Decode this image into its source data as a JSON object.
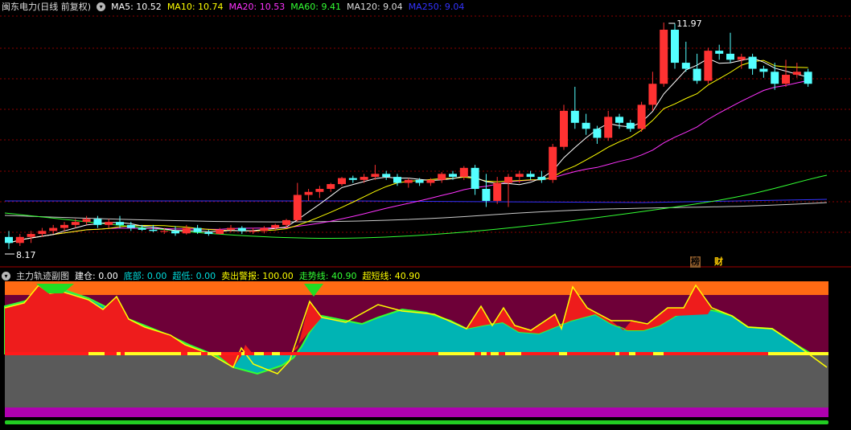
{
  "main": {
    "title": "闽东电力(日线 前复权)",
    "indicators": [
      {
        "label": "MA5: 10.52",
        "color": "#ffffff"
      },
      {
        "label": "MA10: 10.74",
        "color": "#ffff00"
      },
      {
        "label": "MA20: 10.53",
        "color": "#ff33ff"
      },
      {
        "label": "MA60: 9.41",
        "color": "#33ff33"
      },
      {
        "label": "MA120: 9.04",
        "color": "#dddddd"
      },
      {
        "label": "MA250: 9.04",
        "color": "#3333ff"
      }
    ],
    "high_label": "11.97",
    "low_label": "8.17",
    "tags": [
      "榜",
      "财"
    ]
  },
  "sub": {
    "title": "主力轨迹副图",
    "indicators": [
      {
        "label": "建仓: 0.00",
        "color": "#ffffff"
      },
      {
        "label": "底部: 0.00",
        "color": "#00dddd"
      },
      {
        "label": "超低: 0.00",
        "color": "#00dddd"
      },
      {
        "label": "卖出警报: 100.00",
        "color": "#ffff00"
      },
      {
        "label": "走势线: 40.90",
        "color": "#33ff33"
      },
      {
        "label": "超短线: 40.90",
        "color": "#ffff00"
      }
    ]
  },
  "colors": {
    "up": "#ff3232",
    "down": "#54ffff",
    "grid": "#8b0000"
  },
  "chart_data": {
    "type": "candlestick",
    "candles": [
      [
        8.4,
        8.5,
        8.2,
        8.3
      ],
      [
        8.3,
        8.45,
        8.25,
        8.4
      ],
      [
        8.4,
        8.5,
        8.3,
        8.45
      ],
      [
        8.45,
        8.55,
        8.4,
        8.5
      ],
      [
        8.5,
        8.6,
        8.45,
        8.55
      ],
      [
        8.55,
        8.65,
        8.5,
        8.6
      ],
      [
        8.6,
        8.7,
        8.55,
        8.65
      ],
      [
        8.65,
        8.75,
        8.6,
        8.7
      ],
      [
        8.7,
        8.75,
        8.55,
        8.6
      ],
      [
        8.6,
        8.7,
        8.55,
        8.65
      ],
      [
        8.65,
        8.75,
        8.55,
        8.6
      ],
      [
        8.6,
        8.65,
        8.5,
        8.55
      ],
      [
        8.55,
        8.6,
        8.5,
        8.52
      ],
      [
        8.52,
        8.6,
        8.48,
        8.5
      ],
      [
        8.5,
        8.55,
        8.45,
        8.5
      ],
      [
        8.5,
        8.58,
        8.42,
        8.46
      ],
      [
        8.46,
        8.6,
        8.44,
        8.55
      ],
      [
        8.55,
        8.6,
        8.45,
        8.48
      ],
      [
        8.48,
        8.52,
        8.42,
        8.45
      ],
      [
        8.45,
        8.55,
        8.44,
        8.52
      ],
      [
        8.52,
        8.6,
        8.48,
        8.55
      ],
      [
        8.55,
        8.58,
        8.45,
        8.5
      ],
      [
        8.5,
        8.55,
        8.45,
        8.5
      ],
      [
        8.5,
        8.58,
        8.46,
        8.55
      ],
      [
        8.55,
        8.62,
        8.5,
        8.6
      ],
      [
        8.6,
        8.7,
        8.55,
        8.68
      ],
      [
        8.68,
        9.3,
        8.65,
        9.1
      ],
      [
        9.1,
        9.2,
        9.0,
        9.15
      ],
      [
        9.15,
        9.25,
        9.05,
        9.2
      ],
      [
        9.2,
        9.3,
        9.15,
        9.28
      ],
      [
        9.28,
        9.4,
        9.25,
        9.38
      ],
      [
        9.38,
        9.42,
        9.3,
        9.35
      ],
      [
        9.35,
        9.45,
        9.3,
        9.4
      ],
      [
        9.4,
        9.6,
        9.35,
        9.45
      ],
      [
        9.45,
        9.5,
        9.35,
        9.4
      ],
      [
        9.4,
        9.45,
        9.25,
        9.3
      ],
      [
        9.3,
        9.38,
        9.22,
        9.35
      ],
      [
        9.35,
        9.38,
        9.25,
        9.3
      ],
      [
        9.3,
        9.38,
        9.25,
        9.35
      ],
      [
        9.35,
        9.48,
        9.3,
        9.45
      ],
      [
        9.45,
        9.5,
        9.35,
        9.4
      ],
      [
        9.4,
        9.58,
        9.35,
        9.55
      ],
      [
        9.55,
        9.6,
        9.1,
        9.2
      ],
      [
        9.2,
        9.45,
        8.9,
        9.0
      ],
      [
        9.0,
        9.4,
        8.95,
        9.3
      ],
      [
        9.3,
        9.45,
        8.9,
        9.4
      ],
      [
        9.4,
        9.5,
        9.3,
        9.45
      ],
      [
        9.45,
        9.5,
        9.35,
        9.4
      ],
      [
        9.4,
        9.5,
        9.3,
        9.35
      ],
      [
        9.35,
        9.95,
        9.3,
        9.9
      ],
      [
        9.9,
        10.6,
        9.85,
        10.5
      ],
      [
        10.5,
        10.9,
        10.2,
        10.3
      ],
      [
        10.3,
        10.45,
        10.1,
        10.2
      ],
      [
        10.2,
        10.25,
        9.95,
        10.05
      ],
      [
        10.05,
        10.5,
        10.0,
        10.4
      ],
      [
        10.4,
        10.45,
        10.2,
        10.3
      ],
      [
        10.3,
        10.35,
        10.15,
        10.2
      ],
      [
        10.2,
        10.65,
        10.15,
        10.6
      ],
      [
        10.6,
        11.15,
        10.5,
        10.95
      ],
      [
        10.95,
        11.97,
        10.9,
        11.85
      ],
      [
        11.85,
        11.95,
        11.2,
        11.3
      ],
      [
        11.3,
        11.65,
        11.15,
        11.2
      ],
      [
        11.2,
        11.45,
        10.95,
        11.0
      ],
      [
        11.0,
        11.55,
        10.95,
        11.5
      ],
      [
        11.5,
        11.6,
        11.35,
        11.45
      ],
      [
        11.45,
        11.8,
        11.3,
        11.35
      ],
      [
        11.35,
        11.45,
        11.2,
        11.4
      ],
      [
        11.4,
        11.45,
        11.1,
        11.2
      ],
      [
        11.2,
        11.25,
        11.05,
        11.15
      ],
      [
        11.15,
        11.3,
        10.85,
        10.95
      ],
      [
        10.95,
        11.35,
        10.9,
        11.1
      ],
      [
        11.1,
        11.3,
        11.05,
        11.15
      ],
      [
        11.15,
        11.2,
        10.9,
        10.95
      ]
    ]
  }
}
